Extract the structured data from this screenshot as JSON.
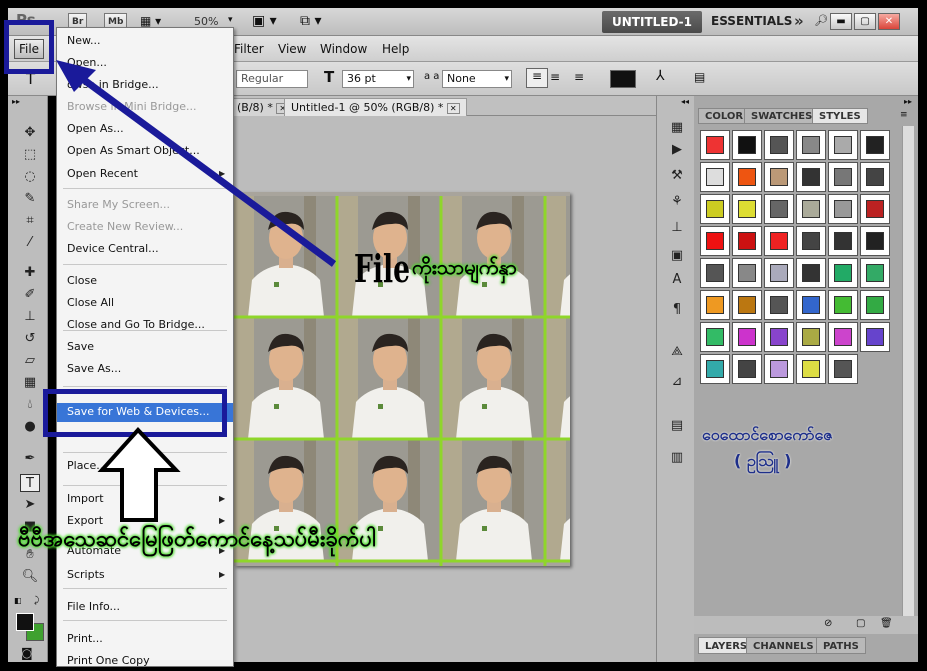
{
  "appbar": {
    "btn_br": "Br",
    "btn_mb": "Mb",
    "zoom": "50%",
    "doc_title": "UNTITLED-1",
    "workspace": "ESSENTIALS",
    "overflow": "»"
  },
  "menus": [
    "Filter",
    "View",
    "Window",
    "Help"
  ],
  "file_button": "File",
  "options": {
    "font_style": "Regular",
    "font_size": "36 pt",
    "aa_label": "a a",
    "aa_value": "None"
  },
  "doc_tabs": [
    {
      "label": "(B/8) *"
    },
    {
      "label": "Untitled-1 @ 50% (RGB/8) *"
    }
  ],
  "panel_tabs": [
    "COLOR",
    "SWATCHES",
    "STYLES"
  ],
  "bottom_tabs": [
    "LAYERS",
    "CHANNELS",
    "PATHS"
  ],
  "file_menu": {
    "items": [
      {
        "label": "New...",
        "disabled": false
      },
      {
        "label": "Open...",
        "disabled": false
      },
      {
        "label": "owse in Bridge...",
        "disabled": false
      },
      {
        "label": "Browse in Mini Bridge...",
        "disabled": true
      },
      {
        "label": "Open As...",
        "disabled": false
      },
      {
        "label": "Open As Smart Object...",
        "disabled": false
      },
      {
        "label": "Open Recent",
        "disabled": false,
        "submenu": true
      },
      {
        "label": "Share My Screen...",
        "disabled": true
      },
      {
        "label": "Create New Review...",
        "disabled": true
      },
      {
        "label": "Device Central...",
        "disabled": false
      },
      {
        "label": "Close",
        "disabled": false
      },
      {
        "label": "Close All",
        "disabled": false
      },
      {
        "label": "Close and Go To Bridge...",
        "disabled": false
      },
      {
        "label": "Save",
        "disabled": false
      },
      {
        "label": "Save As...",
        "disabled": false
      },
      {
        "label": "Save for Web & Devices...",
        "disabled": false,
        "highlighted": true
      },
      {
        "label": "Place...",
        "disabled": false
      },
      {
        "label": "Import",
        "disabled": false,
        "submenu": true
      },
      {
        "label": "Export",
        "disabled": false,
        "submenu": true
      },
      {
        "label": "Automate",
        "disabled": false,
        "submenu": true
      },
      {
        "label": "Scripts",
        "disabled": false,
        "submenu": true
      },
      {
        "label": "File Info...",
        "disabled": false
      },
      {
        "label": "Print...",
        "disabled": false
      },
      {
        "label": "Print One Copy",
        "disabled": false
      }
    ]
  },
  "annotations": {
    "file_word": "File",
    "file_caption": "ကိုးသာမျက်နှာ",
    "bottom_caption": "ဗီဗီအသေဆင်မြေဖြတ်ကောင်နေ့သပ်မီးခိုက်ပါ",
    "watermark_line1": "ဝေထောင်စောကော်ဇေ",
    "watermark_line2": "( ဥသြူ )"
  },
  "colors": {
    "highlight": "#3875d7",
    "annotation_blue": "#1a1a9a",
    "grid_green": "#8fd62a"
  }
}
